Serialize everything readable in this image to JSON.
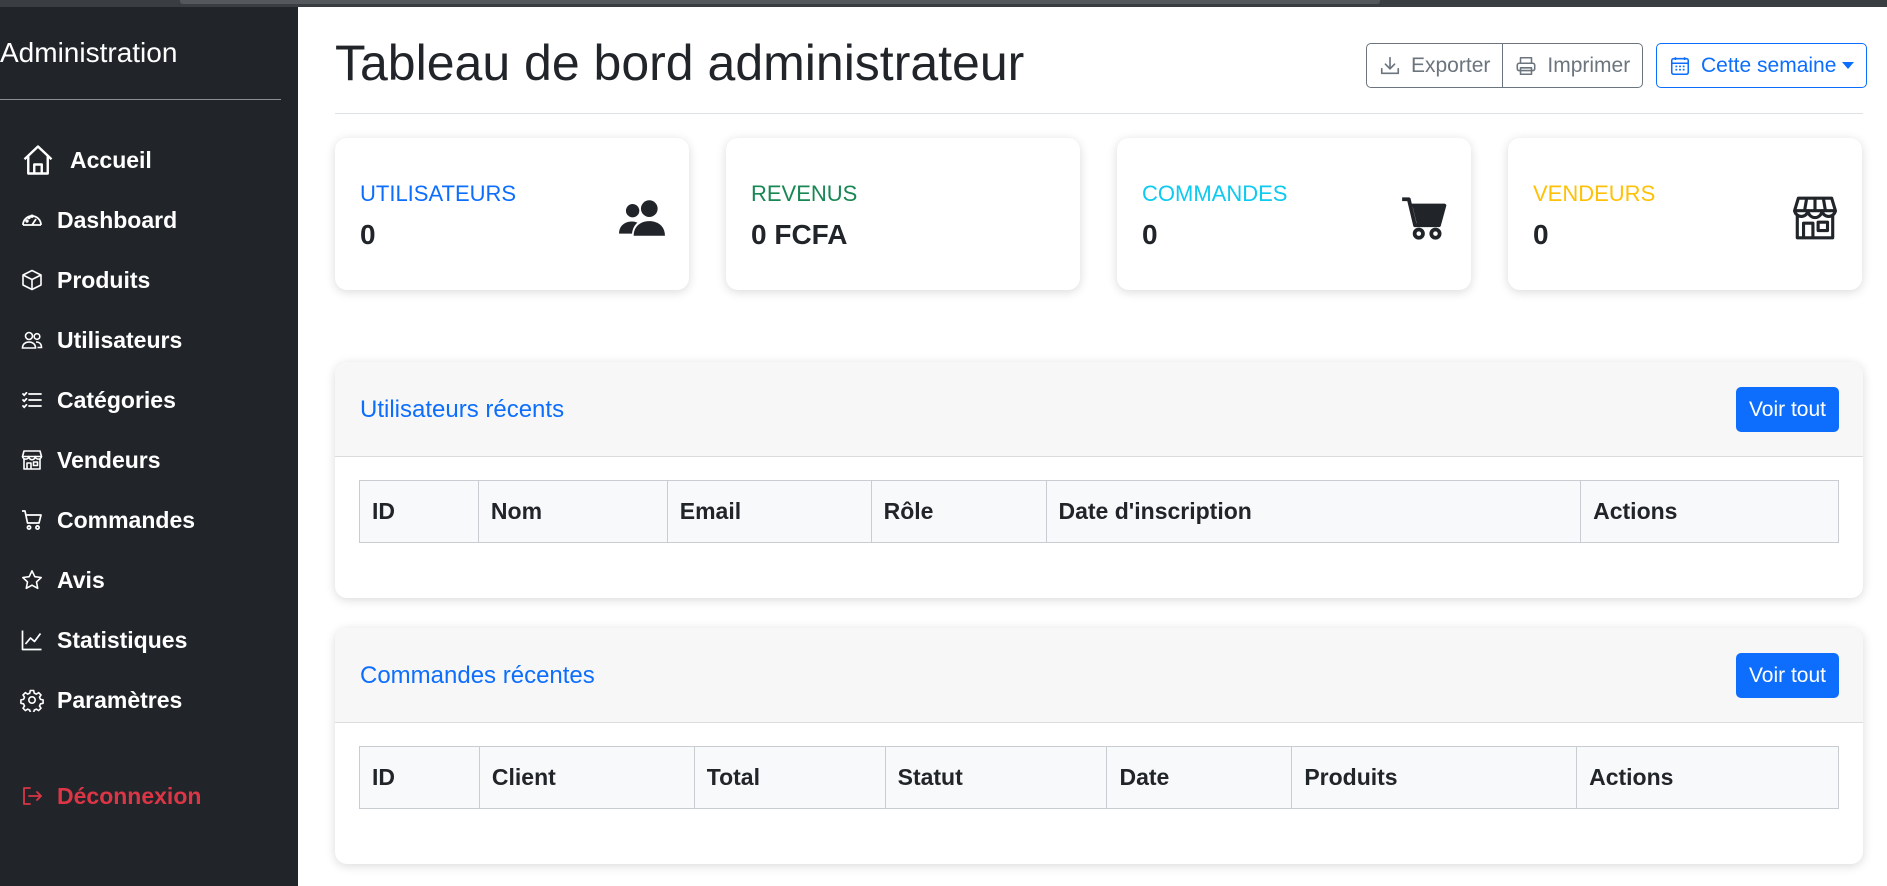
{
  "sidebar": {
    "brand": "Administration",
    "items": [
      {
        "label": "Accueil",
        "icon": "house-icon"
      },
      {
        "label": "Dashboard",
        "icon": "speedometer-icon"
      },
      {
        "label": "Produits",
        "icon": "box-icon"
      },
      {
        "label": "Utilisateurs",
        "icon": "people-icon"
      },
      {
        "label": "Catégories",
        "icon": "list-icon"
      },
      {
        "label": "Vendeurs",
        "icon": "shop-icon"
      },
      {
        "label": "Commandes",
        "icon": "cart-icon"
      },
      {
        "label": "Avis",
        "icon": "star-icon"
      },
      {
        "label": "Statistiques",
        "icon": "graph-icon"
      },
      {
        "label": "Paramètres",
        "icon": "gear-icon"
      }
    ],
    "logout": {
      "label": "Déconnexion",
      "icon": "logout-icon",
      "color": "#dc3545"
    }
  },
  "header": {
    "title": "Tableau de bord administrateur",
    "export_label": "Exporter",
    "print_label": "Imprimer",
    "period_label": "Cette semaine"
  },
  "stats": [
    {
      "label": "UTILISATEURS",
      "value": "0",
      "color": "#0d6efd",
      "icon": "people-fill-icon"
    },
    {
      "label": "REVENUS",
      "value": "0 FCFA",
      "color": "#198754",
      "icon": ""
    },
    {
      "label": "COMMANDES",
      "value": "0",
      "color": "#0dcaf0",
      "icon": "cart-fill-icon"
    },
    {
      "label": "VENDEURS",
      "value": "0",
      "color": "#ffc107",
      "icon": "shop-icon"
    }
  ],
  "recent_users": {
    "title": "Utilisateurs récents",
    "button": "Voir tout",
    "columns": [
      "ID",
      "Nom",
      "Email",
      "Rôle",
      "Date d'inscription",
      "Actions"
    ]
  },
  "recent_orders": {
    "title": "Commandes récentes",
    "button": "Voir tout",
    "columns": [
      "ID",
      "Client",
      "Total",
      "Statut",
      "Date",
      "Produits",
      "Actions"
    ]
  },
  "colors": {
    "primary": "#0d6efd",
    "sidebar_bg": "#212529",
    "danger": "#dc3545"
  }
}
